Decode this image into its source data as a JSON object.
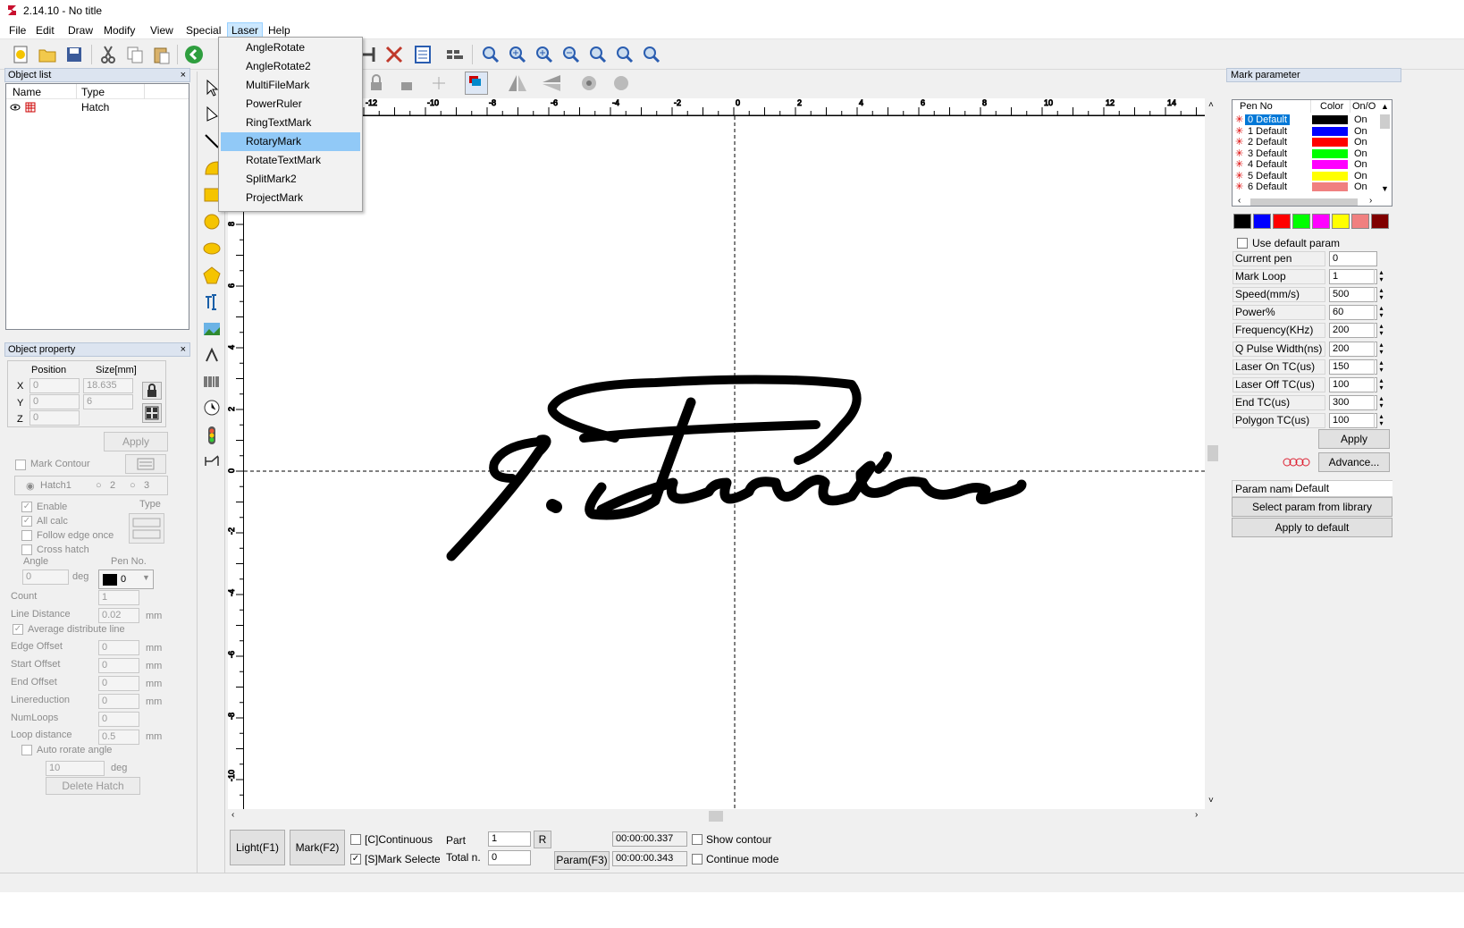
{
  "window": {
    "title": "2.14.10 - No title"
  },
  "menu": {
    "items": [
      {
        "label": "File",
        "active": false
      },
      {
        "label": "Edit",
        "active": false
      },
      {
        "label": "Draw",
        "active": false
      },
      {
        "label": "Modify",
        "active": false
      },
      {
        "label": "View",
        "active": false
      },
      {
        "label": "Special",
        "active": false
      },
      {
        "label": "Laser",
        "active": true
      },
      {
        "label": "Help",
        "active": false
      }
    ]
  },
  "laser_menu": {
    "items": [
      "AngleRotate",
      "AngleRotate2",
      "MultiFileMark",
      "PowerRuler",
      "RingTextMark",
      "RotaryMark",
      "RotateTextMark",
      "SplitMark2",
      "ProjectMark"
    ],
    "highlighted": "RotaryMark"
  },
  "object_list": {
    "title": "Object list",
    "close": "×",
    "columns": [
      "Name",
      "Type"
    ],
    "rows": [
      {
        "name": "",
        "type": "Hatch"
      }
    ]
  },
  "object_property": {
    "title": "Object property",
    "close": "×",
    "position_label": "Position",
    "size_label": "Size[mm]",
    "x_label": "X",
    "y_label": "Y",
    "z_label": "Z",
    "x": "0",
    "y": "0",
    "z": "0",
    "size_x": "18.635",
    "size_y": "6",
    "apply": "Apply",
    "mark_contour": "Mark Contour",
    "hatch1": "Hatch1",
    "hatch2": "2",
    "hatch3": "3",
    "enable": "Enable",
    "all_calc": "All calc",
    "follow_edge_once": "Follow edge once",
    "cross_hatch": "Cross hatch",
    "type_label": "Type",
    "angle_label": "Angle",
    "angle": "0",
    "deg": "deg",
    "pen_no_label": "Pen No.",
    "pen_no": "0",
    "count_label": "Count",
    "count": "1",
    "line_distance_label": "Line Distance",
    "line_distance": "0.02",
    "avg_distribute": "Average distribute line",
    "edge_offset_label": "Edge Offset",
    "edge_offset": "0",
    "start_offset_label": "Start Offset",
    "start_offset": "0",
    "end_offset_label": "End Offset",
    "end_offset": "0",
    "linereduction_label": "Linereduction",
    "linereduction": "0",
    "numloops_label": "NumLoops",
    "numloops": "0",
    "loop_distance_label": "Loop distance",
    "loop_distance": "0.5",
    "auto_rotate": "Auto rorate angle",
    "auto_rotate_value": "10",
    "deg2": "deg",
    "mm": "mm",
    "delete_hatch": "Delete Hatch"
  },
  "ruler": {
    "top_labels": [
      "-12",
      "-10",
      "-8",
      "-6",
      "-4",
      "-2",
      "0",
      "2",
      "4",
      "6",
      "8",
      "10",
      "12",
      "14"
    ],
    "left_labels": [
      "8",
      "6",
      "4",
      "2",
      "0",
      "-2",
      "-4",
      "-6",
      "-8",
      "-10"
    ]
  },
  "mark_parameter": {
    "title": "Mark parameter",
    "columns": [
      "Pen No",
      "Color",
      "On/O"
    ],
    "pens": [
      {
        "label": "0 Default",
        "color": "#000000",
        "state": "On"
      },
      {
        "label": "1 Default",
        "color": "#0000ff",
        "state": "On"
      },
      {
        "label": "2 Default",
        "color": "#ff0000",
        "state": "On"
      },
      {
        "label": "3 Default",
        "color": "#00ff00",
        "state": "On"
      },
      {
        "label": "4 Default",
        "color": "#ff00ff",
        "state": "On"
      },
      {
        "label": "5 Default",
        "color": "#ffff00",
        "state": "On"
      },
      {
        "label": "6 Default",
        "color": "#f08080",
        "state": "On"
      }
    ],
    "palette": [
      "#000000",
      "#0000ff",
      "#ff0000",
      "#00ff00",
      "#ff00ff",
      "#ffff00",
      "#f08080",
      "#800000"
    ],
    "use_default_param": "Use default param",
    "params": [
      {
        "label": "Current pen",
        "value": "0"
      },
      {
        "label": "Mark Loop",
        "value": "1"
      },
      {
        "label": "Speed(mm/s)",
        "value": "500"
      },
      {
        "label": "Power%",
        "value": "60"
      },
      {
        "label": "Frequency(KHz)",
        "value": "200"
      },
      {
        "label": "Q Pulse Width(ns)",
        "value": "200"
      },
      {
        "label": "Laser On TC(us)",
        "value": "150"
      },
      {
        "label": "Laser Off TC(us)",
        "value": "100"
      },
      {
        "label": "End TC(us)",
        "value": "300"
      },
      {
        "label": "Polygon TC(us)",
        "value": "100"
      }
    ],
    "apply": "Apply",
    "advance": "Advance...",
    "param_name_label": "Param name",
    "param_name": "Default",
    "select_param": "Select param from library",
    "apply_default": "Apply to default"
  },
  "bottom": {
    "light": "Light(F1)",
    "mark": "Mark(F2)",
    "continuous": "[C]Continuous",
    "mark_selected": "[S]Mark Selectec",
    "part_label": "Part",
    "part": "1",
    "r": "R",
    "total_label": "Total n.",
    "total": "0",
    "param": "Param(F3)",
    "time1": "00:00:00.337",
    "time2": "00:00:00.343",
    "show_contour": "Show contour",
    "continue_mode": "Continue mode"
  }
}
